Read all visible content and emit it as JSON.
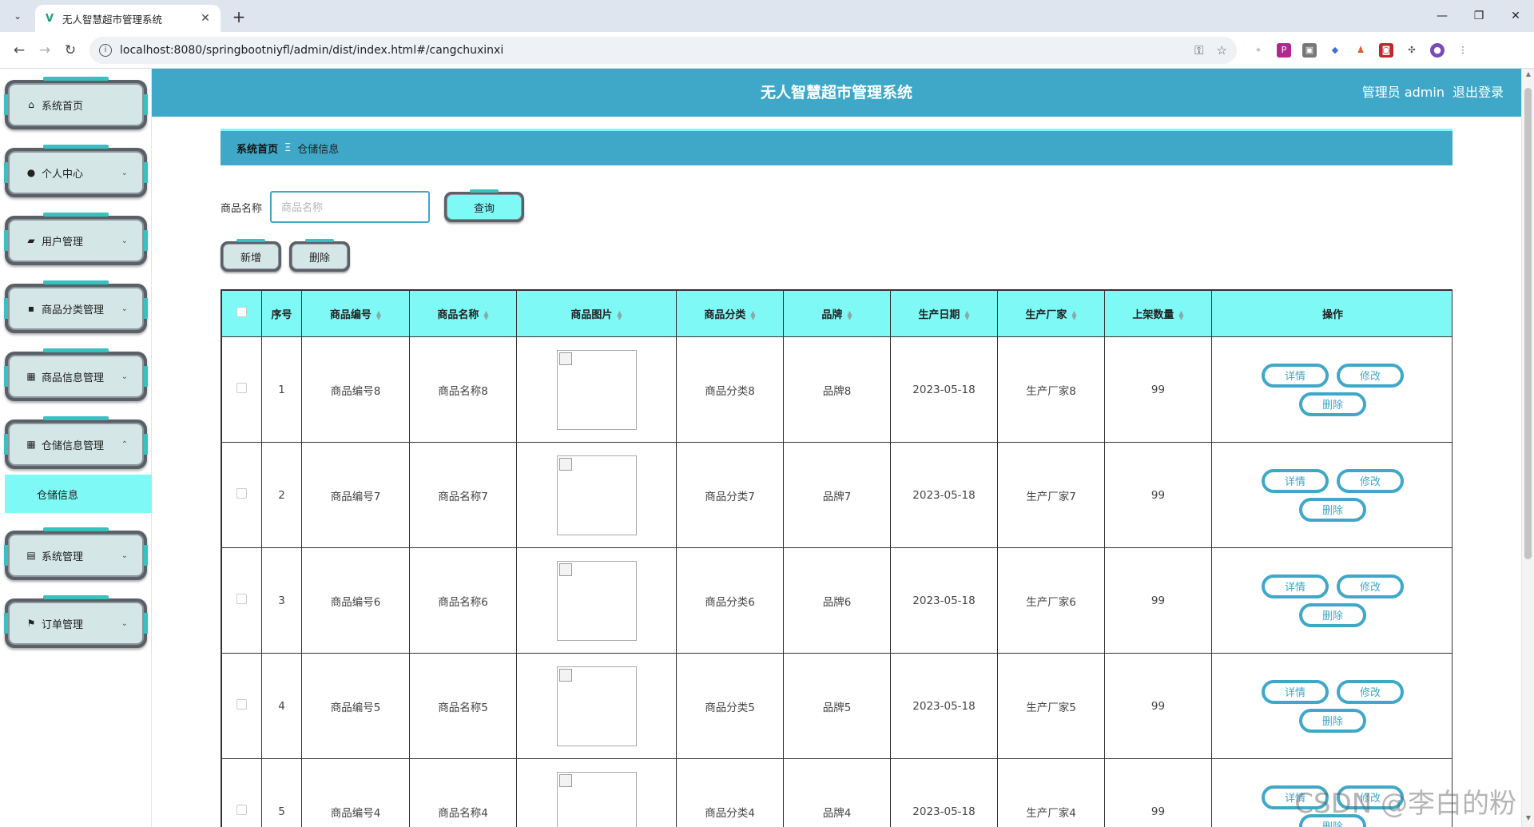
{
  "browser": {
    "tab_title": "无人智慧超市管理系统",
    "url": "localhost:8080/springbootniyfl/admin/dist/index.html#/cangchuxinxi"
  },
  "header": {
    "title": "无人智慧超市管理系统",
    "user_label": "管理员 admin",
    "logout_label": "退出登录"
  },
  "sidebar": {
    "items": [
      {
        "label": "系统首页",
        "icon": "home-icon"
      },
      {
        "label": "个人中心",
        "icon": "user-icon"
      },
      {
        "label": "用户管理",
        "icon": "briefcase-icon"
      },
      {
        "label": "商品分类管理",
        "icon": "chat-icon"
      },
      {
        "label": "商品信息管理",
        "icon": "grid-icon"
      },
      {
        "label": "仓储信息管理",
        "icon": "grid-icon"
      },
      {
        "label": "系统管理",
        "icon": "clipboard-icon"
      },
      {
        "label": "订单管理",
        "icon": "flag-icon"
      }
    ],
    "submenu_active": "仓储信息"
  },
  "breadcrumb": {
    "home": "系统首页",
    "separator": "Ξ",
    "current": "仓储信息"
  },
  "search": {
    "label": "商品名称",
    "placeholder": "商品名称",
    "query_button": "查询"
  },
  "actions": {
    "add_button": "新增",
    "delete_button": "删除"
  },
  "table": {
    "headers": [
      "序号",
      "商品编号",
      "商品名称",
      "商品图片",
      "商品分类",
      "品牌",
      "生产日期",
      "生产厂家",
      "上架数量",
      "操作"
    ],
    "rows": [
      {
        "index": "1",
        "code": "商品编号8",
        "name": "商品名称8",
        "category": "商品分类8",
        "brand": "品牌8",
        "date": "2023-05-18",
        "maker": "生产厂家8",
        "qty": "99"
      },
      {
        "index": "2",
        "code": "商品编号7",
        "name": "商品名称7",
        "category": "商品分类7",
        "brand": "品牌7",
        "date": "2023-05-18",
        "maker": "生产厂家7",
        "qty": "99"
      },
      {
        "index": "3",
        "code": "商品编号6",
        "name": "商品名称6",
        "category": "商品分类6",
        "brand": "品牌6",
        "date": "2023-05-18",
        "maker": "生产厂家6",
        "qty": "99"
      },
      {
        "index": "4",
        "code": "商品编号5",
        "name": "商品名称5",
        "category": "商品分类5",
        "brand": "品牌5",
        "date": "2023-05-18",
        "maker": "生产厂家5",
        "qty": "99"
      },
      {
        "index": "5",
        "code": "商品编号4",
        "name": "商品名称4",
        "category": "商品分类4",
        "brand": "品牌4",
        "date": "2023-05-18",
        "maker": "生产厂家4",
        "qty": "99"
      }
    ],
    "op_labels": {
      "detail": "详情",
      "edit": "修改",
      "delete": "删除"
    }
  },
  "watermark": "CSDN @李白的粉",
  "colors": {
    "primary": "#3fa8c8",
    "accent_cyan": "#7ef9f6",
    "menu_face": "#d4e6e6",
    "menu_frame": "#5a6068"
  }
}
